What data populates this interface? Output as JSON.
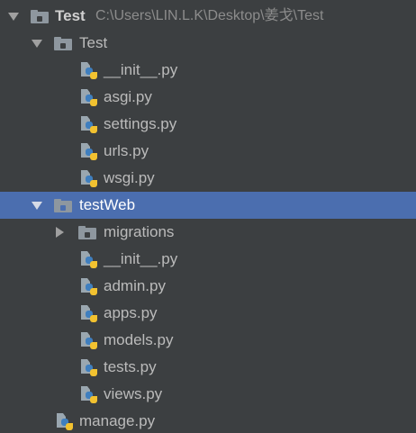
{
  "project_tree": {
    "root": {
      "label": "Test",
      "path": "C:\\Users\\LIN.L.K\\Desktop\\姜戈\\Test"
    },
    "items": [
      {
        "label": "Test",
        "type": "folder",
        "state": "expanded"
      },
      {
        "label": "__init__.py",
        "type": "python-file"
      },
      {
        "label": "asgi.py",
        "type": "python-file"
      },
      {
        "label": "settings.py",
        "type": "python-file"
      },
      {
        "label": "urls.py",
        "type": "python-file"
      },
      {
        "label": "wsgi.py",
        "type": "python-file"
      },
      {
        "label": "testWeb",
        "type": "folder",
        "state": "expanded",
        "selected": true
      },
      {
        "label": "migrations",
        "type": "folder",
        "state": "collapsed"
      },
      {
        "label": "__init__.py",
        "type": "python-file"
      },
      {
        "label": "admin.py",
        "type": "python-file"
      },
      {
        "label": "apps.py",
        "type": "python-file"
      },
      {
        "label": "models.py",
        "type": "python-file"
      },
      {
        "label": "tests.py",
        "type": "python-file"
      },
      {
        "label": "views.py",
        "type": "python-file"
      },
      {
        "label": "manage.py",
        "type": "python-file"
      }
    ]
  },
  "colors": {
    "background": "#3c3f41",
    "selection": "#4b6eaf",
    "text": "#bbbbbb",
    "path_text": "#8c8c8c",
    "folder_icon": "#8e979f",
    "python_blue": "#3f7fbf",
    "python_yellow": "#f2c230"
  }
}
